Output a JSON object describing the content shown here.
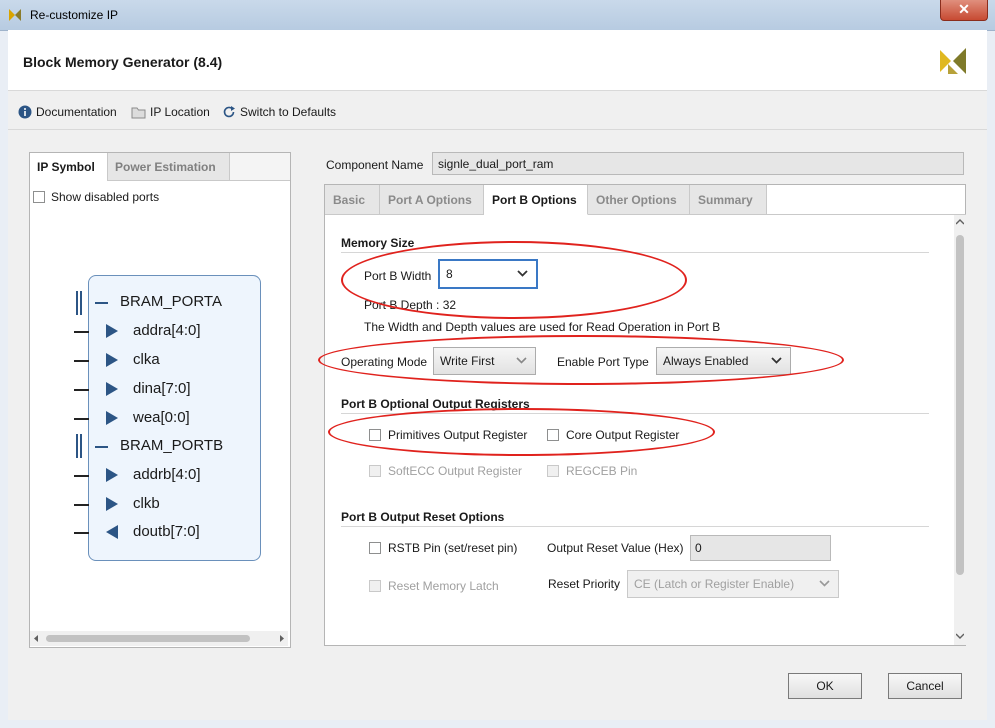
{
  "window": {
    "title": "Re-customize IP"
  },
  "header": {
    "title": "Block Memory Generator (8.4)"
  },
  "toolbar": {
    "documentation": "Documentation",
    "ip_location": "IP Location",
    "switch_defaults": "Switch to Defaults"
  },
  "left_panel": {
    "tabs": [
      "IP Symbol",
      "Power Estimation"
    ],
    "show_disabled_label": "Show disabled ports",
    "symbol": {
      "porta": "BRAM_PORTA",
      "porta_pins": [
        "addra[4:0]",
        "clka",
        "dina[7:0]",
        "wea[0:0]"
      ],
      "portb": "BRAM_PORTB",
      "portb_pins": [
        "addrb[4:0]",
        "clkb",
        "doutb[7:0]"
      ]
    }
  },
  "component": {
    "label": "Component Name",
    "value": "signle_dual_port_ram"
  },
  "tabs": [
    "Basic",
    "Port A Options",
    "Port B Options",
    "Other Options",
    "Summary"
  ],
  "active_tab": "Port B Options",
  "memory_size": {
    "title": "Memory Size",
    "width_label": "Port B Width",
    "width_value": "8",
    "depth_text": "Port B Depth : 32",
    "note": "The Width and Depth values are used for Read Operation in Port B"
  },
  "operating": {
    "mode_label": "Operating Mode",
    "mode_value": "Write First",
    "enable_label": "Enable Port Type",
    "enable_value": "Always Enabled"
  },
  "output_registers": {
    "title": "Port B Optional Output Registers",
    "primitives": "Primitives Output Register",
    "core": "Core Output Register",
    "softecc": "SoftECC Output Register",
    "regceb": "REGCEB Pin"
  },
  "reset_options": {
    "title": "Port B Output Reset Options",
    "rstb": "RSTB Pin (set/reset pin)",
    "reset_value_label": "Output Reset Value (Hex)",
    "reset_value": "0",
    "reset_latch": "Reset Memory Latch",
    "priority_label": "Reset Priority",
    "priority_value": "CE (Latch or Register Enable)"
  },
  "buttons": {
    "ok": "OK",
    "cancel": "Cancel"
  },
  "colors": {
    "accent": "#2c5585",
    "annotation": "#e0221d"
  }
}
